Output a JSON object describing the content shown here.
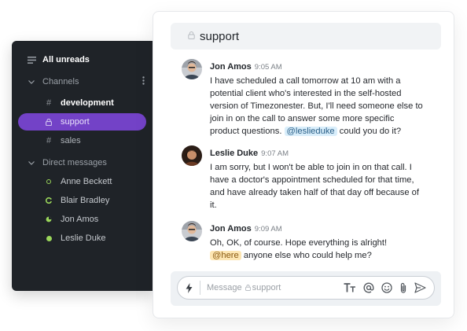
{
  "sidebar": {
    "all_unreads": "All unreads",
    "channels_label": "Channels",
    "channels": [
      {
        "name": "development",
        "bold": true
      },
      {
        "name": "support",
        "active": true
      },
      {
        "name": "sales"
      }
    ],
    "dm_label": "Direct messages",
    "direct_messages": [
      {
        "name": "Anne Beckett",
        "status": "ring"
      },
      {
        "name": "Blair Bradley",
        "status": "partial"
      },
      {
        "name": "Jon Amos",
        "status": "partial"
      },
      {
        "name": "Leslie Duke",
        "status": "online"
      }
    ]
  },
  "channel": {
    "title": "support"
  },
  "messages": [
    {
      "author": "Jon Amos",
      "time": "9:05 AM",
      "lines": [
        "I have scheduled a call tomorrow at 10 am with a",
        "potential client who's interested in the self-hosted",
        "version of Timezonester. But, I'll need someone else to",
        "join in on the call to answer some more specific"
      ],
      "last_line_prefix": "product questions.",
      "mention": "@leslieduke",
      "last_line_suffix": "could you do it?"
    },
    {
      "author": "Leslie Duke",
      "time": "9:07 AM",
      "lines": [
        "I am sorry, but I won't be able to join in on that call. I",
        "have a doctor's appointment scheduled for that time,",
        "and have already taken half of that day off because of",
        "it."
      ]
    },
    {
      "author": "Jon Amos",
      "time": "9:09 AM",
      "line1": "Oh, OK, of course. Hope everything is alright!",
      "mention": "@here",
      "line2_suffix": "anyone else who could help me?"
    }
  ],
  "composer": {
    "placeholder": "Message",
    "channel": "support"
  },
  "colors": {
    "sidebar_bg": "#1f2328",
    "active_channel": "#7342c7",
    "online": "#9ad65a",
    "mention_bg": "#d9eefb",
    "here_bg": "#fde6b3"
  }
}
